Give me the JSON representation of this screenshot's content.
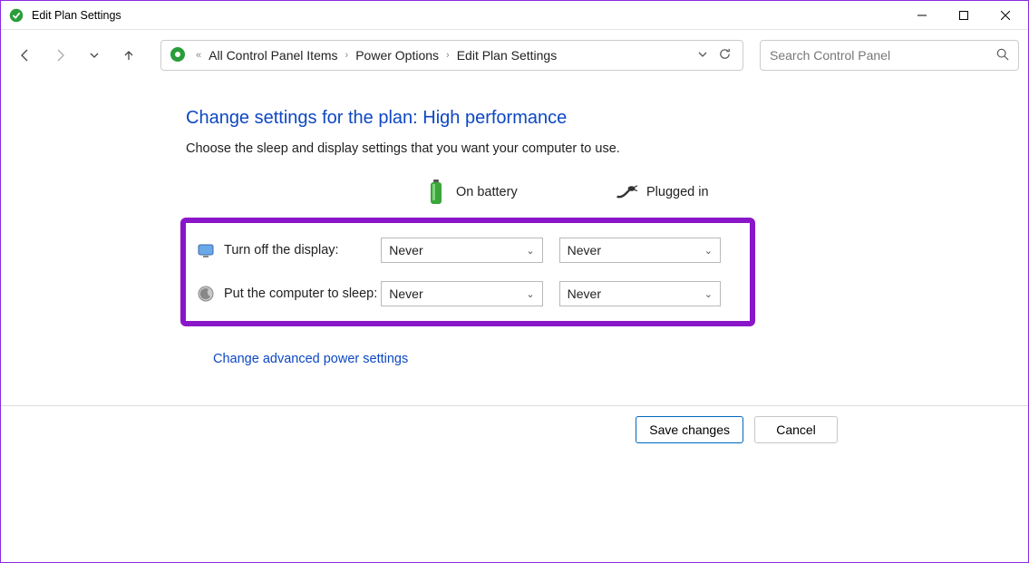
{
  "window": {
    "title": "Edit Plan Settings"
  },
  "breadcrumb": {
    "item1": "All Control Panel Items",
    "item2": "Power Options",
    "item3": "Edit Plan Settings"
  },
  "search": {
    "placeholder": "Search Control Panel"
  },
  "page": {
    "heading": "Change settings for the plan: High performance",
    "subtext": "Choose the sleep and display settings that you want your computer to use."
  },
  "columns": {
    "battery": "On battery",
    "plugged": "Plugged in"
  },
  "rows": {
    "display": {
      "label": "Turn off the display:",
      "battery": "Never",
      "plugged": "Never"
    },
    "sleep": {
      "label": "Put the computer to sleep:",
      "battery": "Never",
      "plugged": "Never"
    }
  },
  "links": {
    "advanced": "Change advanced power settings"
  },
  "buttons": {
    "save": "Save changes",
    "cancel": "Cancel"
  }
}
